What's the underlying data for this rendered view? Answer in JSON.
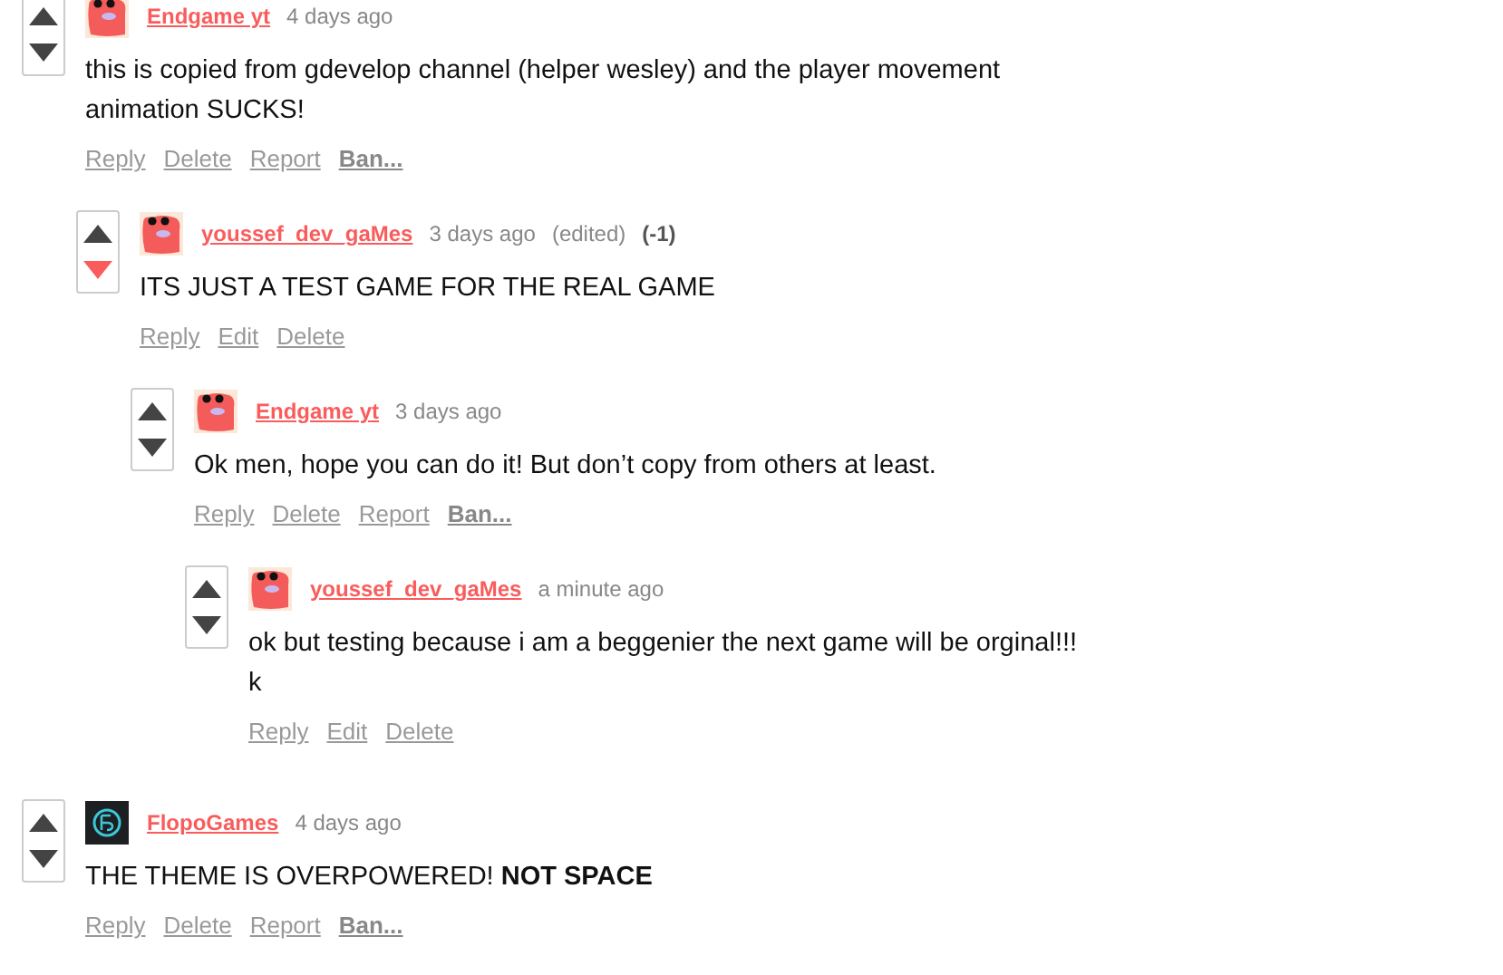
{
  "comments": [
    {
      "author": "Endgame yt",
      "time": "4 days ago",
      "avatar": {
        "kind": "blob"
      },
      "downvoted": false,
      "body": [
        "this is copied from gdevelop channel (helper wesley) and the player movement",
        "animation SUCKS!"
      ],
      "actions": [
        {
          "label": "Reply",
          "bold": false
        },
        {
          "label": "Delete",
          "bold": false
        },
        {
          "label": "Report",
          "bold": false
        },
        {
          "label": "Ban...",
          "bold": true
        }
      ],
      "children": [
        {
          "author": "youssef_dev_gaMes",
          "time": "3 days ago",
          "edited": "(edited)",
          "score": "(-1)",
          "avatar": {
            "kind": "blob"
          },
          "downvoted": true,
          "body": [
            "ITS JUST A TEST GAME FOR THE REAL GAME"
          ],
          "actions": [
            {
              "label": "Reply",
              "bold": false
            },
            {
              "label": "Edit",
              "bold": false
            },
            {
              "label": "Delete",
              "bold": false
            }
          ],
          "children": [
            {
              "author": "Endgame yt",
              "time": "3 days ago",
              "avatar": {
                "kind": "blob"
              },
              "downvoted": false,
              "body": [
                "Ok men, hope you can do it! But don’t copy from others at least."
              ],
              "actions": [
                {
                  "label": "Reply",
                  "bold": false
                },
                {
                  "label": "Delete",
                  "bold": false
                },
                {
                  "label": "Report",
                  "bold": false
                },
                {
                  "label": "Ban...",
                  "bold": true
                }
              ],
              "children": [
                {
                  "author": "youssef_dev_gaMes",
                  "time": "a minute ago",
                  "avatar": {
                    "kind": "blob"
                  },
                  "downvoted": false,
                  "body": [
                    "ok but testing because i am a beggenier the next game will be orginal!!!",
                    "k"
                  ],
                  "actions": [
                    {
                      "label": "Reply",
                      "bold": false
                    },
                    {
                      "label": "Edit",
                      "bold": false
                    },
                    {
                      "label": "Delete",
                      "bold": false
                    }
                  ]
                }
              ]
            }
          ]
        }
      ]
    },
    {
      "author": "FlopoGames",
      "time": "4 days ago",
      "avatar": {
        "kind": "logo"
      },
      "downvoted": false,
      "body": [
        "THE THEME IS OVERPOWERED! **NOT SPACE**"
      ],
      "actions": [
        {
          "label": "Reply",
          "bold": false
        },
        {
          "label": "Delete",
          "bold": false
        },
        {
          "label": "Report",
          "bold": false
        },
        {
          "label": "Ban...",
          "bold": true
        }
      ]
    }
  ]
}
